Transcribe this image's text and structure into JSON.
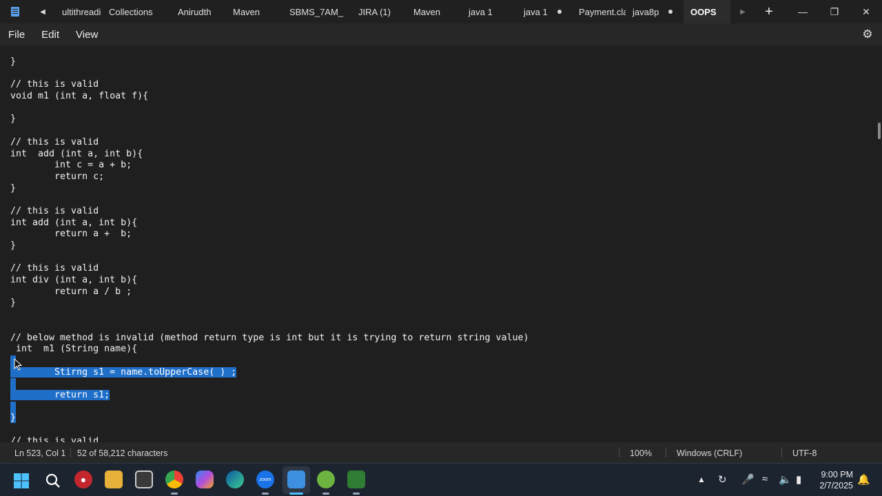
{
  "tabs": [
    {
      "label": "ultithreadi",
      "active": false,
      "modified": false
    },
    {
      "label": "Collections",
      "active": false,
      "modified": false
    },
    {
      "label": "Anirudth",
      "active": false,
      "modified": false
    },
    {
      "label": "Maven",
      "active": false,
      "modified": false
    },
    {
      "label": "SBMS_7AM_",
      "active": false,
      "modified": false
    },
    {
      "label": "JIRA (1)",
      "active": false,
      "modified": false
    },
    {
      "label": "Maven",
      "active": false,
      "modified": false
    },
    {
      "label": "java 1",
      "active": false,
      "modified": false
    },
    {
      "label": "java 1",
      "active": false,
      "modified": true
    },
    {
      "label": "Payment.clas",
      "active": false,
      "modified": false
    },
    {
      "label": "java8p",
      "active": false,
      "modified": true
    },
    {
      "label": "OOPS",
      "active": true,
      "modified": true
    }
  ],
  "menu": {
    "file": "File",
    "edit": "Edit",
    "view": "View"
  },
  "code_lines": [
    {
      "text": "}",
      "sel": ""
    },
    {
      "text": "",
      "sel": ""
    },
    {
      "text": "// this is valid",
      "sel": ""
    },
    {
      "text": "void m1 (int a, float f){",
      "sel": ""
    },
    {
      "text": "",
      "sel": ""
    },
    {
      "text": "}",
      "sel": ""
    },
    {
      "text": "",
      "sel": ""
    },
    {
      "text": "// this is valid",
      "sel": ""
    },
    {
      "text": "int  add (int a, int b){",
      "sel": ""
    },
    {
      "text": "        int c = a + b;",
      "sel": ""
    },
    {
      "text": "        return c;",
      "sel": ""
    },
    {
      "text": "}",
      "sel": ""
    },
    {
      "text": "",
      "sel": ""
    },
    {
      "text": "// this is valid",
      "sel": ""
    },
    {
      "text": "int add (int a, int b){",
      "sel": ""
    },
    {
      "text": "        return a +  b;",
      "sel": ""
    },
    {
      "text": "}",
      "sel": ""
    },
    {
      "text": "",
      "sel": ""
    },
    {
      "text": "// this is valid",
      "sel": ""
    },
    {
      "text": "int div (int a, int b){",
      "sel": ""
    },
    {
      "text": "        return a / b ;",
      "sel": ""
    },
    {
      "text": "}",
      "sel": ""
    },
    {
      "text": "",
      "sel": ""
    },
    {
      "text": "",
      "sel": ""
    },
    {
      "text": "// below method is invalid (method return type is int but it is trying to return string value)",
      "sel": ""
    },
    {
      "text": " int  m1 (String name){",
      "sel": ""
    },
    {
      "text": "",
      "sel": "line"
    },
    {
      "text": "        Stirng s1 = name.toUpperCase( ) ;",
      "sel": "text"
    },
    {
      "text": "",
      "sel": "line"
    },
    {
      "text": "        return s1;",
      "sel": "text"
    },
    {
      "text": "",
      "sel": "line"
    },
    {
      "text": "}",
      "sel": "text"
    },
    {
      "text": "",
      "sel": ""
    },
    {
      "text": "// this is valid",
      "sel": ""
    }
  ],
  "status": {
    "position": "Ln 523, Col 1",
    "selection": "52 of 58,212 characters",
    "zoom": "100%",
    "line_ending": "Windows (CRLF)",
    "encoding": "UTF-8"
  },
  "clock": {
    "time": "9:00 PM",
    "date": "2/7/2025"
  },
  "colors": {
    "selection": "#1f6fc9",
    "background": "#1f1f1f"
  }
}
